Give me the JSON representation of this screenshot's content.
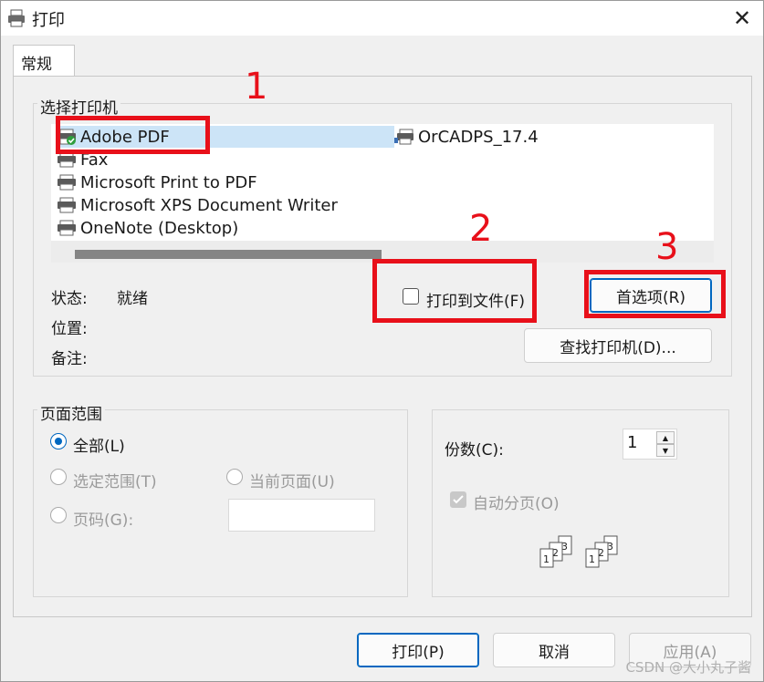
{
  "window": {
    "title": "打印",
    "close_glyph": "✕"
  },
  "tabs": [
    {
      "label": "常规"
    }
  ],
  "printer_section": {
    "title": "选择打印机",
    "printers": [
      {
        "name": "Adobe PDF",
        "icon": "printer-default-icon",
        "selected": true
      },
      {
        "name": "Fax",
        "icon": "printer-icon"
      },
      {
        "name": "Microsoft Print to PDF",
        "icon": "printer-icon"
      },
      {
        "name": "Microsoft XPS Document Writer",
        "icon": "printer-icon"
      },
      {
        "name": "OneNote (Desktop)",
        "icon": "printer-icon"
      },
      {
        "name": "OrCADPS_17.4",
        "icon": "network-printer-icon"
      }
    ],
    "status_label": "状态:",
    "status_value": "就绪",
    "location_label": "位置:",
    "location_value": "",
    "comment_label": "备注:",
    "comment_value": "",
    "print_to_file_label": "打印到文件(F)",
    "print_to_file_checked": false,
    "preferences_label": "首选项(R)",
    "find_printer_label": "查找打印机(D)..."
  },
  "page_range": {
    "title": "页面范围",
    "all_label": "全部(L)",
    "selection_label": "选定范围(T)",
    "current_page_label": "当前页面(U)",
    "pages_label": "页码(G):",
    "pages_value": "",
    "selected": "all"
  },
  "copies": {
    "label": "份数(C):",
    "value": "1",
    "collate_label": "自动分页(O)",
    "collate_checked": true,
    "collate_digits": [
      "1",
      "2",
      "3"
    ]
  },
  "buttons": {
    "print": "打印(P)",
    "cancel": "取消",
    "apply": "应用(A)"
  },
  "annotations": {
    "n1": "1",
    "n2": "2",
    "n3": "3"
  },
  "watermark": "CSDN @大小丸子酱",
  "colors": {
    "accent": "#0067c0",
    "annotation_red": "#e8101a",
    "selection": "#cce4f7"
  }
}
